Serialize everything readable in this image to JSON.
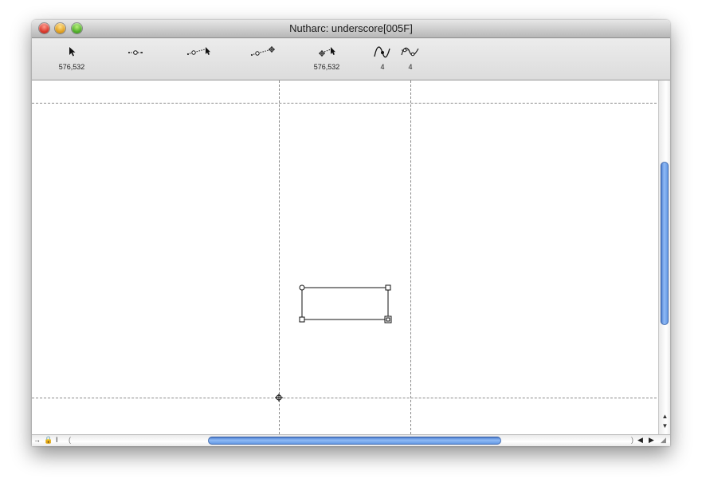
{
  "window": {
    "title": "Nutharc: underscore[005F]"
  },
  "toolbar": {
    "tools": [
      {
        "name": "pointer-tool",
        "icon": "pointer-icon",
        "label": "576,532"
      },
      {
        "name": "point-tool",
        "icon": "curve-point-icon",
        "label": ""
      },
      {
        "name": "pen-tool",
        "icon": "pen-node-icon",
        "label": ""
      },
      {
        "name": "knife-tool",
        "icon": "add-point-icon",
        "label": ""
      },
      {
        "name": "select-point-tool",
        "icon": "select-point-icon",
        "label": "576,532"
      },
      {
        "name": "curve-tool",
        "icon": "curve-icon",
        "label": "4"
      },
      {
        "name": "corner-tool",
        "icon": "corner-icon",
        "label": "4"
      }
    ]
  },
  "status_bar": {
    "icons": [
      "arrow-right-icon",
      "lock-icon",
      "text-cursor-icon"
    ]
  },
  "colors": {
    "scroll_thumb": "#5d93e2",
    "guide_line": "#8a8a8a"
  }
}
